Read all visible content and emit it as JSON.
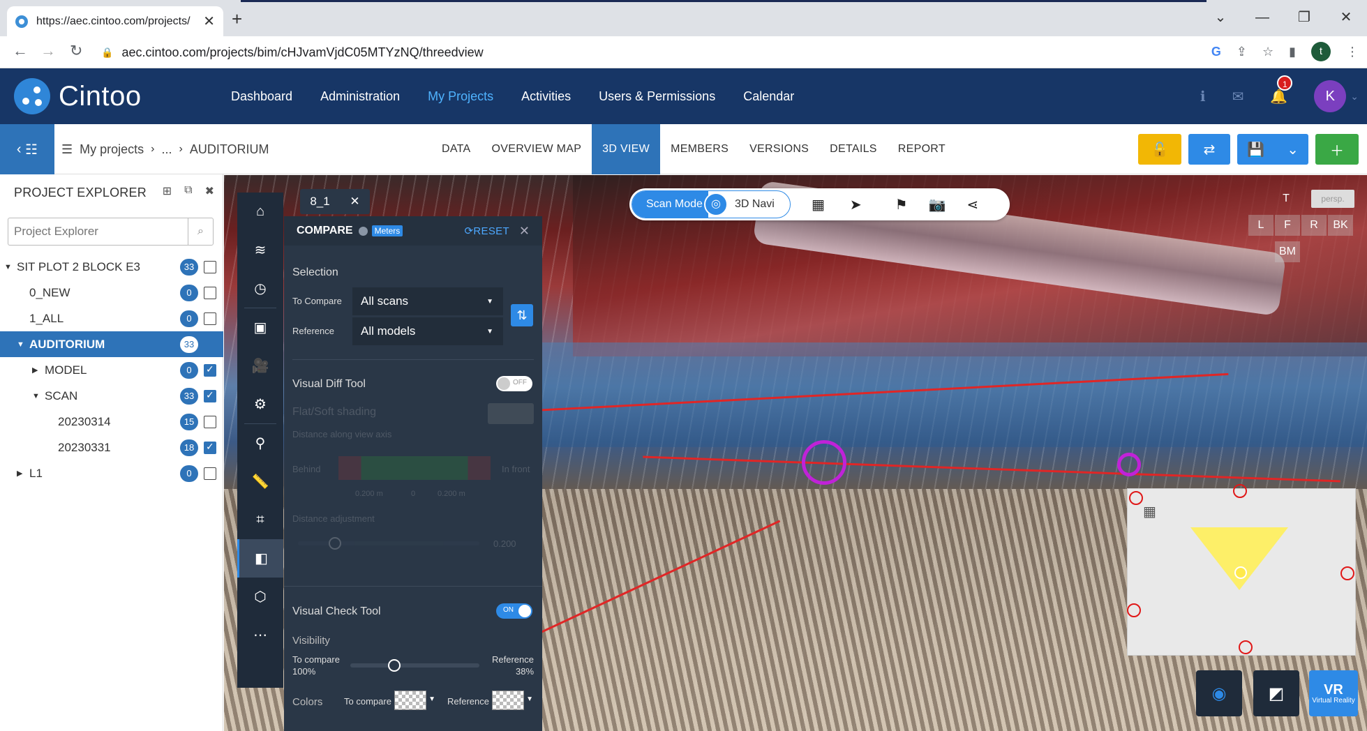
{
  "browser": {
    "tab_title": "https://aec.cintoo.com/projects/",
    "url": "aec.cintoo.com/projects/bim/cHJvamVjdC05MTYzNQ/threedview",
    "profile_initial": "t"
  },
  "app": {
    "logo_text": "Cintoo",
    "nav": [
      "Dashboard",
      "Administration",
      "My Projects",
      "Activities",
      "Users & Permissions",
      "Calendar"
    ],
    "notification_count": "1",
    "avatar_initial": "K"
  },
  "subheader": {
    "crumb_root": "My projects",
    "crumb_mid": "...",
    "crumb_current": "AUDITORIUM",
    "tabs": [
      "DATA",
      "OVERVIEW MAP",
      "3D VIEW",
      "MEMBERS",
      "VERSIONS",
      "DETAILS",
      "REPORT"
    ]
  },
  "explorer": {
    "title": "PROJECT EXPLORER",
    "search_placeholder": "Project Explorer",
    "rows": [
      {
        "label": "SIT PLOT 2 BLOCK E3",
        "count": "33"
      },
      {
        "label": "0_NEW",
        "count": "0"
      },
      {
        "label": "1_ALL",
        "count": "0"
      },
      {
        "label": "AUDITORIUM",
        "count": "33"
      },
      {
        "label": "MODEL",
        "count": "0"
      },
      {
        "label": "SCAN",
        "count": "33"
      },
      {
        "label": "20230314",
        "count": "15"
      },
      {
        "label": "20230331",
        "count": "18"
      },
      {
        "label": "L1",
        "count": "0"
      }
    ]
  },
  "chip": {
    "label": "8_1"
  },
  "compare": {
    "title": "COMPARE",
    "units": "Meters",
    "reset": "RESET",
    "selection": "Selection",
    "to_compare_label": "To Compare",
    "to_compare_value": "All scans",
    "reference_label": "Reference",
    "reference_value": "All models",
    "visual_diff": "Visual Diff Tool",
    "visual_diff_state": "OFF",
    "flat_soft": "Flat/Soft shading",
    "distance_axis": "Distance along view axis",
    "behind": "Behind",
    "in_front": "In front",
    "tick_neg": "0.200 m",
    "tick_zero": "0",
    "tick_pos": "0.200 m",
    "distance_adj": "Distance adjustment",
    "distance_value": "0.200",
    "visual_check": "Visual Check Tool",
    "visual_check_state": "ON",
    "visibility": "Visibility",
    "vis_left_label": "To compare",
    "vis_left_value": "100%",
    "vis_right_label": "Reference",
    "vis_right_value": "38%",
    "visibility_level": 0.62,
    "colors": "Colors",
    "colors_to_compare": "To compare",
    "colors_reference": "Reference"
  },
  "viewer": {
    "scan_mode": "Scan Mode",
    "navi": "3D Navi",
    "views": [
      "T",
      "L",
      "F",
      "R",
      "BK",
      "BM"
    ],
    "persp": "persp.",
    "vr_label": "Virtual Reality",
    "vr_short": "VR"
  },
  "colors": {
    "header": "#173666",
    "accent": "#2e73b8",
    "yellow": "#f2b705",
    "green": "#3aa845",
    "panel": "#2a3747"
  }
}
